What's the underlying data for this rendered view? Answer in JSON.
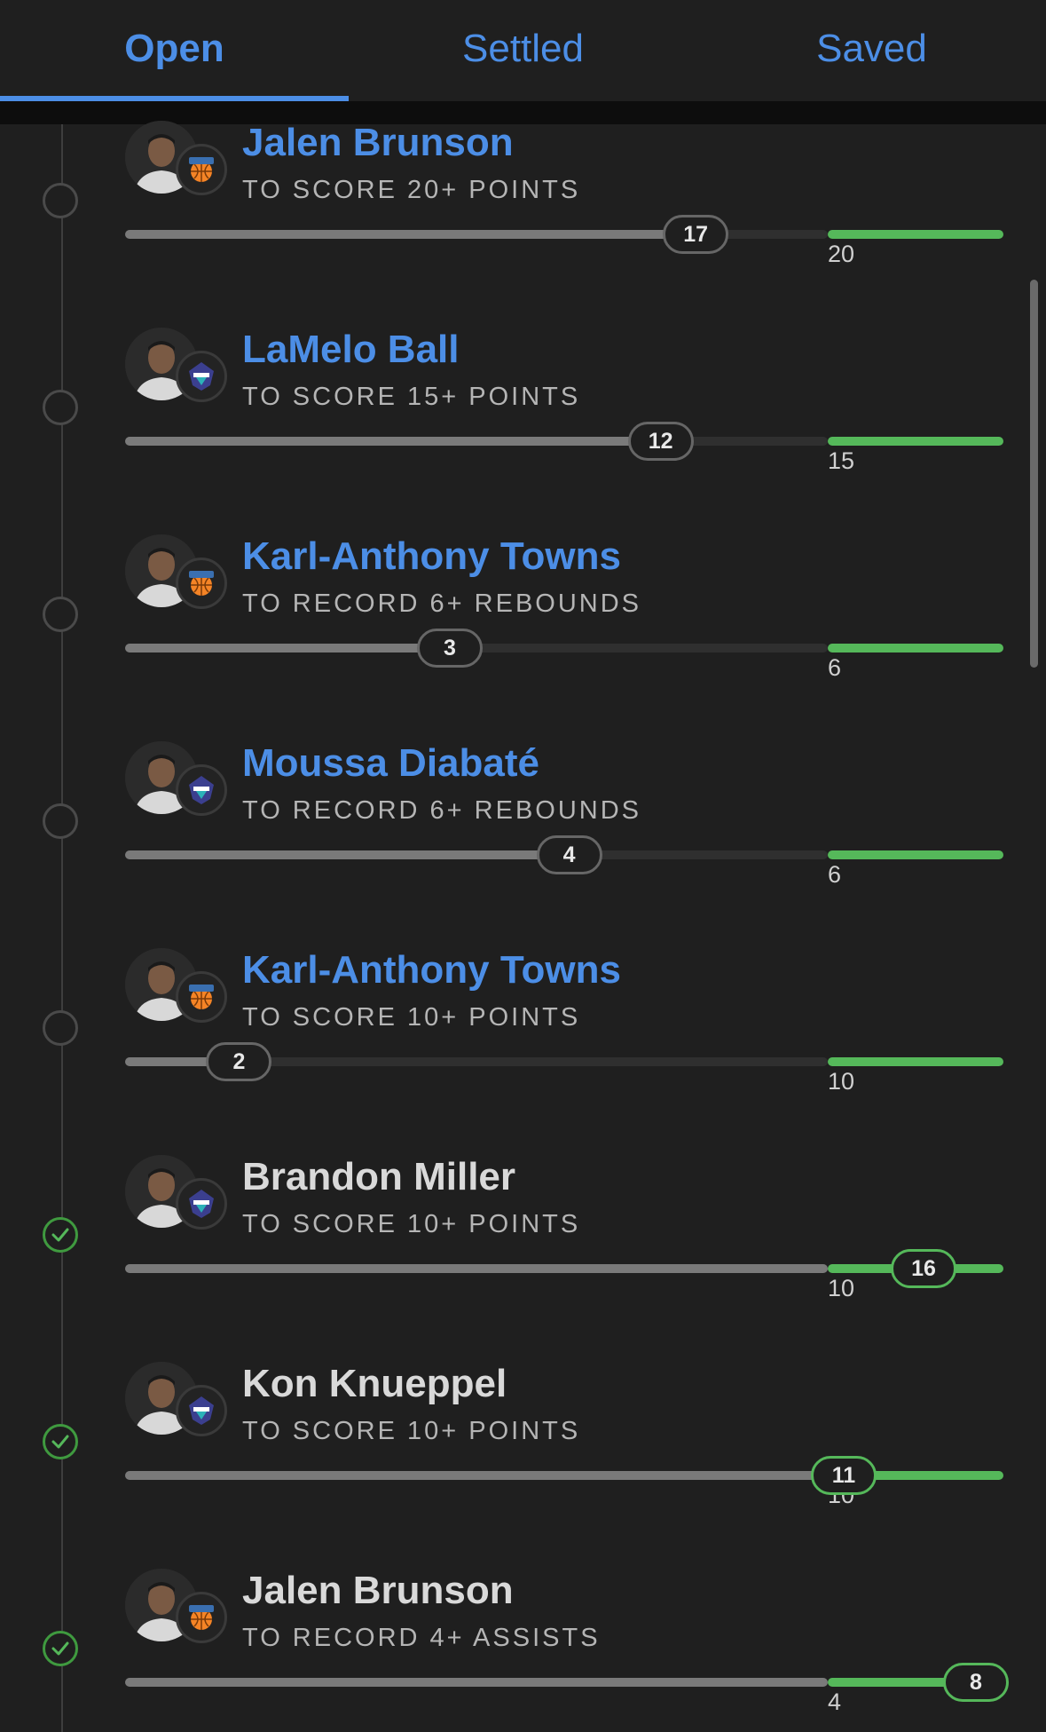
{
  "tabs": [
    {
      "label": "Open",
      "active": true
    },
    {
      "label": "Settled",
      "active": false
    },
    {
      "label": "Saved",
      "active": false
    }
  ],
  "colors": {
    "accent": "#4c8ee6",
    "success": "#55b85a",
    "progress": "#7a7a7a",
    "background": "#1f1f1f"
  },
  "legs": [
    {
      "player": "Jalen Brunson",
      "team_logo": "knicks-logo-icon",
      "market": "TO SCORE 20+ POINTS",
      "current": "17",
      "target": "20",
      "status": "open",
      "progress": 0.85
    },
    {
      "player": "LaMelo Ball",
      "team_logo": "hornets-logo-icon",
      "market": "TO SCORE 15+ POINTS",
      "current": "12",
      "target": "15",
      "status": "open",
      "progress": 0.8
    },
    {
      "player": "Karl-Anthony Towns",
      "team_logo": "knicks-logo-icon",
      "market": "TO RECORD 6+ REBOUNDS",
      "current": "3",
      "target": "6",
      "status": "open",
      "progress": 0.5
    },
    {
      "player": "Moussa Diabaté",
      "team_logo": "hornets-logo-icon",
      "market": "TO RECORD 6+ REBOUNDS",
      "current": "4",
      "target": "6",
      "status": "open",
      "progress": 0.67
    },
    {
      "player": "Karl-Anthony Towns",
      "team_logo": "knicks-logo-icon",
      "market": "TO SCORE 10+ POINTS",
      "current": "2",
      "target": "10",
      "status": "open",
      "progress": 0.2
    },
    {
      "player": "Brandon Miller",
      "team_logo": "hornets-logo-icon",
      "market": "TO SCORE 10+ POINTS",
      "current": "16",
      "target": "10",
      "status": "hit",
      "progress": 1.6
    },
    {
      "player": "Kon Knueppel",
      "team_logo": "hornets-logo-icon",
      "market": "TO SCORE 10+ POINTS",
      "current": "11",
      "target": "10",
      "status": "hit",
      "progress": 1.1
    },
    {
      "player": "Jalen Brunson",
      "team_logo": "knicks-logo-icon",
      "market": "TO RECORD 4+ ASSISTS",
      "current": "8",
      "target": "4",
      "status": "hit",
      "progress": 2.0
    }
  ]
}
